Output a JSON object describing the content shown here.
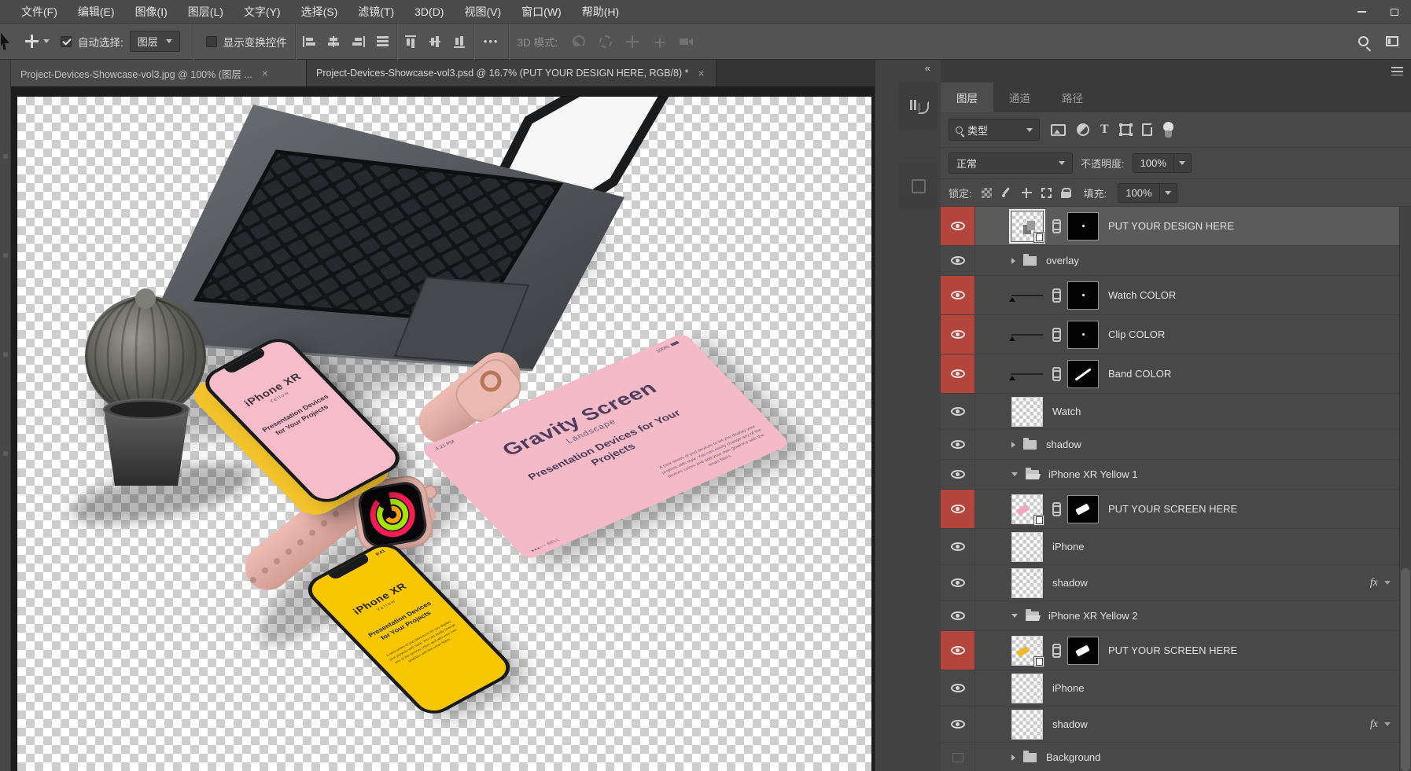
{
  "colors": {
    "accent_red_label": "#b3453c",
    "panel_bg": "#484848",
    "pasteboard": "#1d1d1d",
    "swatch_watch_color": "#d4a58f",
    "swatch_clip_color": "#c89d8c",
    "swatch_band_color": "#fdc9b8",
    "mockup_pink": "#f4bac7",
    "mockup_yellow": "#f8c701"
  },
  "menu_bar": {
    "items": [
      "文件(F)",
      "编辑(E)",
      "图像(I)",
      "图层(L)",
      "文字(Y)",
      "选择(S)",
      "滤镜(T)",
      "3D(D)",
      "视图(V)",
      "窗口(W)",
      "帮助(H)"
    ]
  },
  "options_bar": {
    "auto_select_label": "自动选择:",
    "auto_select_value": "图层",
    "show_transform_label": "显示变换控件",
    "more_label": "•••",
    "mode_3d_label": "3D 模式:"
  },
  "tabs": [
    {
      "title": "Project-Devices-Showcase-vol3.jpg @ 100% (图层 ...",
      "close": "×"
    },
    {
      "title": "Project-Devices-Showcase-vol3.psd @ 16.7% (PUT YOUR DESIGN HERE, RGB/8) *",
      "close": "×"
    }
  ],
  "dock": {
    "collapse": "«"
  },
  "panel": {
    "tabs": [
      "图层",
      "通道",
      "路径"
    ],
    "filter_label": "类型",
    "blend_mode": "正常",
    "opacity_label": "不透明度:",
    "opacity_value": "100%",
    "lock_label": "锁定:",
    "fill_label": "填充:",
    "fill_value": "100%",
    "fx_label": "fx"
  },
  "layers": [
    {
      "name": "PUT YOUR DESIGN HERE",
      "kind": "smart-object-with-mask",
      "color_label": "red",
      "selected": true,
      "visible": true
    },
    {
      "name": "overlay",
      "kind": "group-collapsed",
      "visible": true
    },
    {
      "name": "Watch COLOR",
      "kind": "fill-with-mask",
      "color_label": "red",
      "visible": true
    },
    {
      "name": "Clip COLOR",
      "kind": "fill-with-mask",
      "color_label": "red",
      "visible": true
    },
    {
      "name": "Band COLOR",
      "kind": "fill-with-mask",
      "color_label": "red",
      "visible": true
    },
    {
      "name": "Watch",
      "kind": "pixel",
      "visible": true
    },
    {
      "name": "shadow",
      "kind": "group-collapsed",
      "visible": true
    },
    {
      "name": "iPhone XR Yellow 1",
      "kind": "group-expanded",
      "visible": true
    },
    {
      "name": "PUT YOUR SCREEN HERE",
      "kind": "smart-object-with-mask",
      "color_label": "red",
      "visible": true
    },
    {
      "name": "iPhone",
      "kind": "pixel",
      "visible": true
    },
    {
      "name": "shadow",
      "kind": "pixel",
      "visible": true,
      "fx": true
    },
    {
      "name": "iPhone XR Yellow 2",
      "kind": "group-expanded",
      "visible": true
    },
    {
      "name": "PUT YOUR SCREEN HERE",
      "kind": "smart-object-with-mask",
      "color_label": "red",
      "visible": true
    },
    {
      "name": "iPhone",
      "kind": "pixel",
      "visible": true
    },
    {
      "name": "shadow",
      "kind": "pixel",
      "visible": true,
      "fx": true
    },
    {
      "name": "Background",
      "kind": "group-collapsed",
      "visible": false
    }
  ],
  "canvas": {
    "iphone_pink": {
      "title": "iPhone XR",
      "subtitle": "Yellow",
      "line": "Presentation Devices for Your Projects"
    },
    "iphone_yellow": {
      "title": "iPhone XR",
      "subtitle": "Yellow",
      "line": "Presentation Devices for Your Projects",
      "time": "9:41",
      "paragraph": "A new series of psd devices to let you display your projects with style. You can easily change any of the devices colors and add your own graphics with the smart filters."
    },
    "card": {
      "title": "Gravity Screen",
      "subtitle": "Landscape",
      "line": "Presentation Devices for Your Projects",
      "time": "4:21 PM",
      "battery": "100%",
      "carrier": "●●●○○ BELL",
      "paragraph": "A new series of psd devices to let you display your projects with style. You can easily change any of the devices colors and add your own graphics with the smart filters."
    }
  }
}
